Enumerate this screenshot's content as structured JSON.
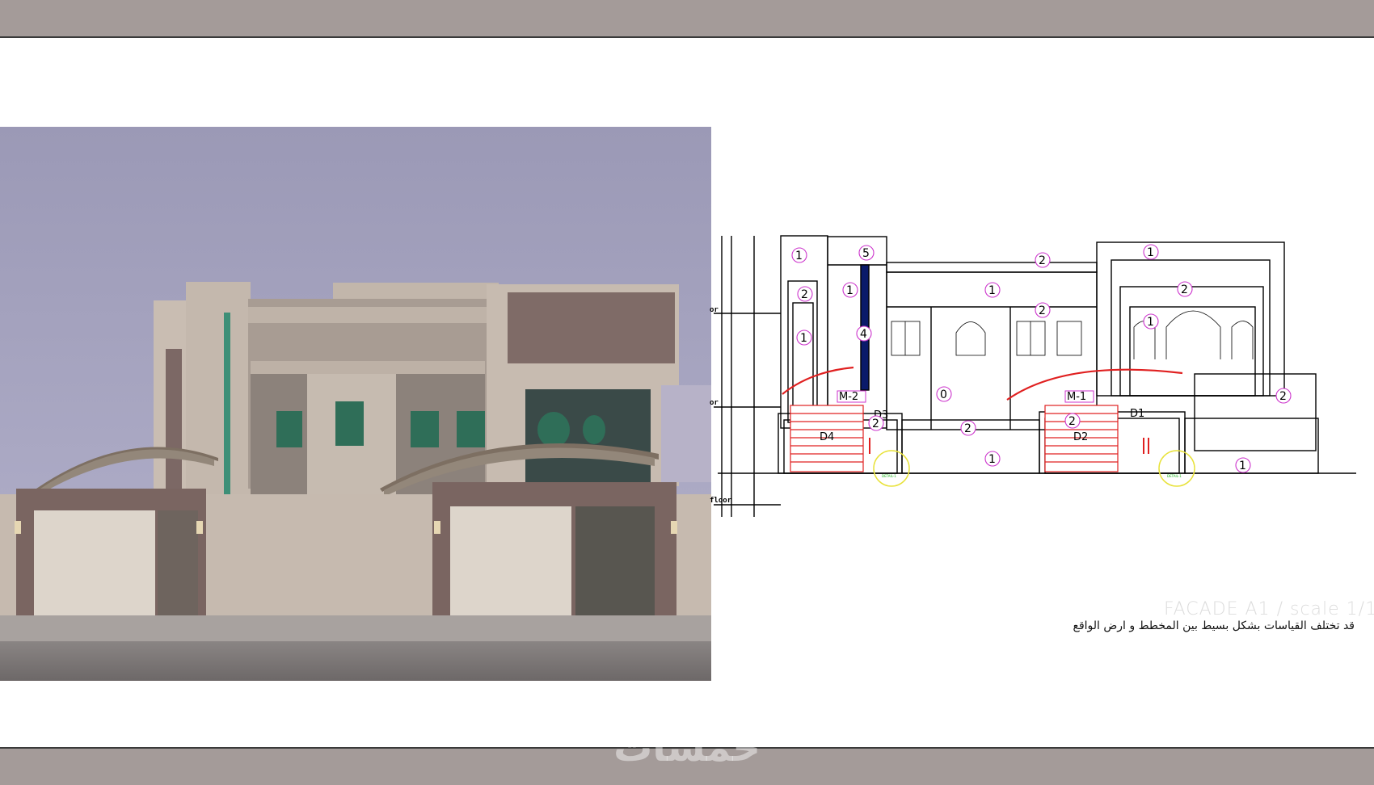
{
  "facade": {
    "title": "FACADE A1  /  scale 1/1",
    "note": "قد تختلف القياسات بشكل بسيط بين المخطط و ارض الواقع"
  },
  "drawing": {
    "floor_labels": [
      "or",
      "or",
      "floor"
    ],
    "tags": {
      "m2": "M-2",
      "m1": "M-1",
      "d1": "D1",
      "d2": "D2",
      "d3": "D3",
      "d4": "D4"
    },
    "material_numbers": {
      "n_1": "1",
      "n_2": "2",
      "n_4": "4",
      "n_5": "5",
      "n_0": "0"
    },
    "detail_label": "DETAIL-1"
  },
  "watermark": "خمسات",
  "colors": {
    "band": "#a49b99",
    "material_circle": "#cc33cc",
    "detail_circle": "#e8e23a",
    "door_red": "#e02020",
    "window_blue": "#0a1a6a"
  }
}
